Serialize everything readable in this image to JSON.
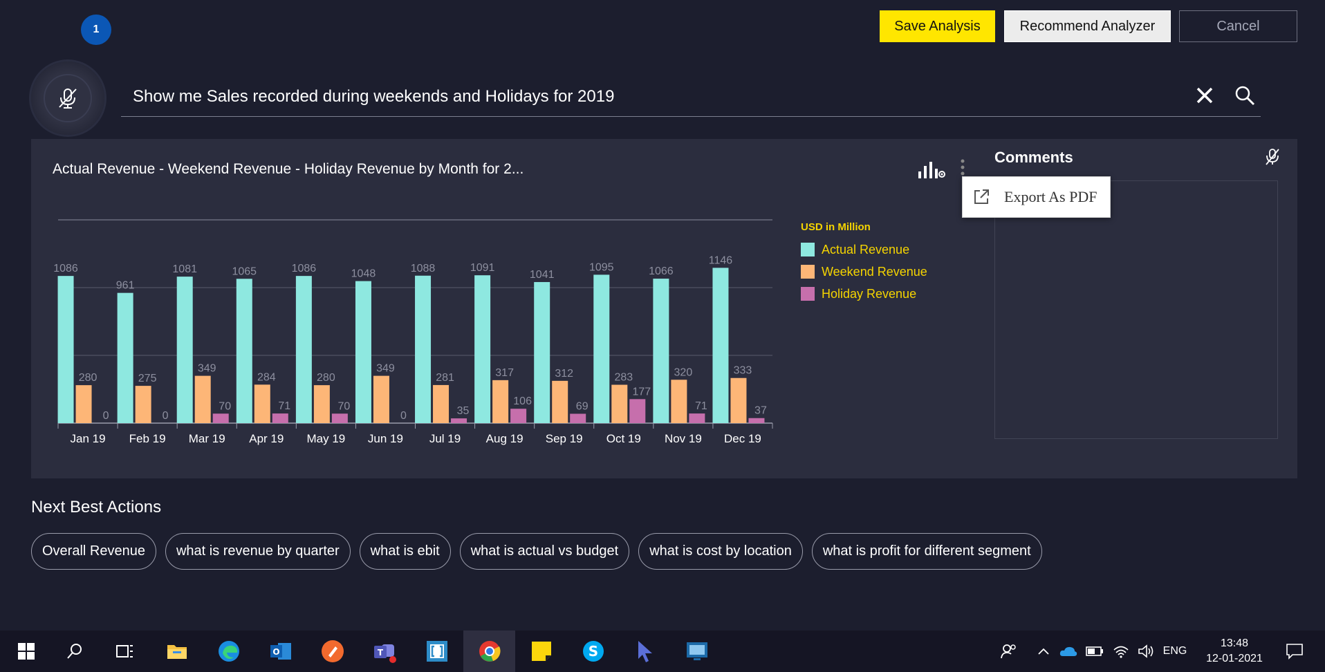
{
  "header": {
    "step_badge": "1",
    "save_label": "Save Analysis",
    "recommend_label": "Recommend Analyzer",
    "cancel_label": "Cancel"
  },
  "search": {
    "query": "Show me Sales recorded during weekends and Holidays for 2019"
  },
  "chart_card": {
    "title": "Actual Revenue - Weekend Revenue - Holiday Revenue by Month for 2...",
    "legend_title": "USD in Million",
    "menu": {
      "export_label": "Export As PDF"
    }
  },
  "comments": {
    "title": "Comments"
  },
  "chart_data": {
    "type": "bar",
    "categories": [
      "Jan 19",
      "Feb 19",
      "Mar 19",
      "Apr 19",
      "May 19",
      "Jun 19",
      "Jul 19",
      "Aug 19",
      "Sep 19",
      "Oct 19",
      "Nov 19",
      "Dec 19"
    ],
    "ylabel": "USD in Million",
    "ylim": [
      0,
      1500
    ],
    "grid": true,
    "legend_position": "right",
    "series": [
      {
        "name": "Actual Revenue",
        "color": "#8ee8e0",
        "values": [
          1086,
          961,
          1081,
          1065,
          1086,
          1048,
          1088,
          1091,
          1041,
          1095,
          1066,
          1146
        ]
      },
      {
        "name": "Weekend Revenue",
        "color": "#fdb677",
        "values": [
          280,
          275,
          349,
          284,
          280,
          349,
          281,
          317,
          312,
          283,
          320,
          333
        ]
      },
      {
        "name": "Holiday Revenue",
        "color": "#c66fac",
        "values": [
          0,
          0,
          70,
          71,
          70,
          0,
          35,
          106,
          69,
          177,
          71,
          37
        ]
      }
    ]
  },
  "next_best_actions": {
    "title": "Next Best Actions",
    "items": [
      "Overall Revenue",
      "what is revenue by quarter",
      "what is ebit",
      "what is actual vs budget",
      "what is cost by location",
      "what is profit for different segment"
    ]
  },
  "taskbar": {
    "apps": [
      "windows-start",
      "search",
      "task-view",
      "file-explorer",
      "edge",
      "outlook",
      "pen-app",
      "teams",
      "bracket-app",
      "chrome",
      "sticky-notes",
      "skype",
      "pointer-app",
      "remote-desktop"
    ],
    "language": "ENG",
    "time": "13:48",
    "date": "12-01-2021"
  }
}
